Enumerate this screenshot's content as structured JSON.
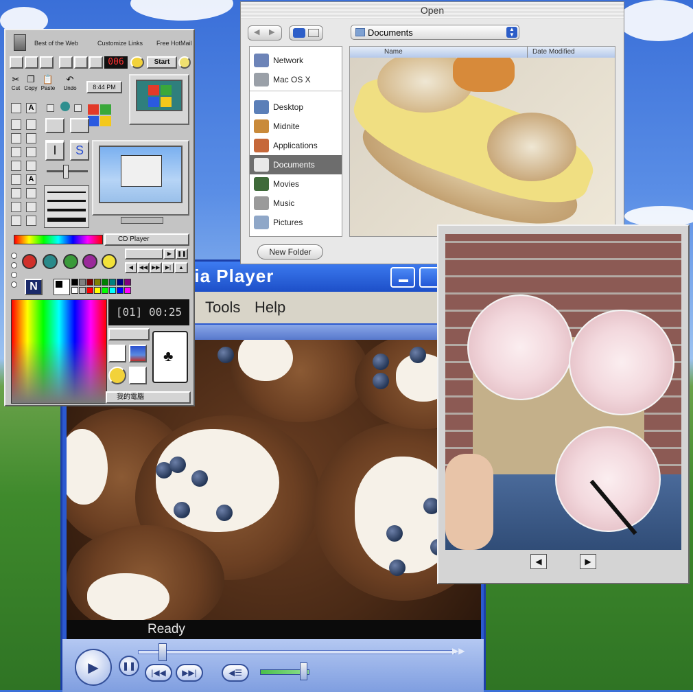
{
  "media_player": {
    "title": "edia Player",
    "menu": {
      "tools": "Tools",
      "help": "Help"
    },
    "status": "Ready"
  },
  "toolbox": {
    "links": {
      "best": "Best of the Web",
      "customize": "Customize Links",
      "hotmail": "Free HotMail"
    },
    "counter": "006",
    "start": "Start",
    "tools": {
      "cut": "Cut",
      "copy": "Copy",
      "paste": "Paste",
      "undo": "Undo"
    },
    "clock": "8:44 PM",
    "cd_player": "CD Player",
    "track_time": "[01] 00:25",
    "taskbar_label": "我的電腦",
    "palette": [
      "#000000",
      "#808080",
      "#800000",
      "#808000",
      "#008000",
      "#008080",
      "#000080",
      "#800080",
      "#ffffff",
      "#c0c0c0",
      "#ff0000",
      "#ffff00",
      "#00ff00",
      "#00ffff",
      "#0000ff",
      "#ff00ff"
    ]
  },
  "open_dialog": {
    "title": "Open",
    "location": "Documents",
    "sidebar": [
      {
        "label": "Network",
        "color": "#6d84b8"
      },
      {
        "label": "Mac OS X",
        "color": "#9aa0a8"
      },
      {
        "label": "Desktop",
        "color": "#5b7fb8"
      },
      {
        "label": "Midnite",
        "color": "#c98a3a"
      },
      {
        "label": "Applications",
        "color": "#c6683a"
      },
      {
        "label": "Documents",
        "color": "#e8e8e8"
      },
      {
        "label": "Movies",
        "color": "#3f6a3a"
      },
      {
        "label": "Music",
        "color": "#9a9a9a"
      },
      {
        "label": "Pictures",
        "color": "#8fa7c8"
      }
    ],
    "columns": {
      "name": "Name",
      "date": "Date Modified"
    },
    "new_folder": "New Folder"
  }
}
